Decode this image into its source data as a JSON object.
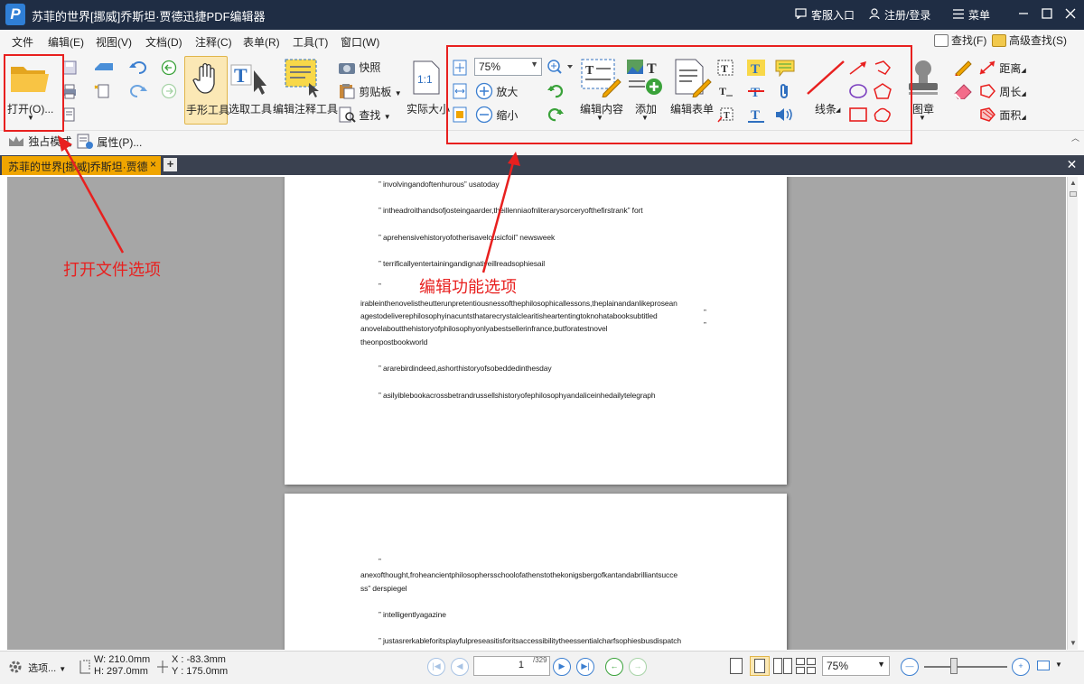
{
  "titlebar": {
    "title": "苏菲的世界[挪威]乔斯坦·贾德迅捷PDF编辑器",
    "service": "客服入口",
    "login": "注册/登录",
    "menu": "菜单"
  },
  "menubar": {
    "items": [
      "文件",
      "编辑(E)",
      "视图(V)",
      "文档(D)",
      "注释(C)",
      "表单(R)",
      "工具(T)",
      "窗口(W)"
    ],
    "find": "查找(F)",
    "advanced_find": "高级查找(S)"
  },
  "ribbon": {
    "open": "打开(O)...",
    "hand_tool": "手形工具",
    "select_tool": "选取工具",
    "edit_annotation_tool": "编辑注释工具",
    "snapshot": "快照",
    "clipboard": "剪贴板",
    "find": "查找",
    "actual_size": "实际大小",
    "zoom_value": "75%",
    "zoom_in": "放大",
    "zoom_out": "缩小",
    "edit_content": "编辑内容",
    "add": "添加",
    "edit_form": "编辑表单",
    "lines": "线条",
    "stamp": "图章",
    "distance": "距离",
    "perimeter": "周长",
    "area": "面积",
    "exclusive_mode": "独占模式",
    "properties": "属性(P)..."
  },
  "tab": {
    "label": "苏菲的世界[挪威]乔斯坦·贾德",
    "close": "×",
    "add": "+"
  },
  "page1": {
    "lines": [
      "” involvingandoftenhurous” usatoday",
      "” intheadroithandsofjosteingaarder,theillenniaofnliterarysorceryofthefirstrank” fort",
      "” aprehensivehistoryofotherisavelousicfoil” newsweek",
      "” terrificallyentertainingandignativeillreadsophiesail",
      "”",
      "irableinthenovelistheutterunpretentiousnessofthephilosophicallessons,theplainandanlikeprosean",
      "agestodeliverephilosophyinacuntsthatarecrystalclearitisheartentingtoknohatabooksubtitled",
      "anovelaboutthehistoryofphilosophyonlyabestsellerinfrance,butforatestnovel",
      "theonpostbookworld",
      "” ararebirdindeed,ashorthistoryofsobeddedinthesday",
      "” asilyiblebookacrossbetrandrussellshistoryofephilosophyandaliceinhedailytelegraph"
    ],
    "trailing_quote": "”"
  },
  "page2": {
    "lines": [
      "”",
      "anexofthought,froheancientphilosophersschoolofathenstothekonigsbergofkantandabrilliantsucce",
      "ss” derspiegel",
      "” intelligentlyagazine",
      "” justasrerkableforitsplayfulpreseasitisforitsaccessibilitytheessentialcharfsophiesbusdispatch"
    ]
  },
  "statusbar": {
    "options": "选项...",
    "width": "W: 210.0mm",
    "height": "H: 297.0mm",
    "x": "X : -83.3mm",
    "y": "Y : 175.0mm",
    "current_page": "1",
    "total_pages": "329",
    "zoom": "75%"
  },
  "annotations": {
    "open_label": "打开文件选项",
    "edit_label": "编辑功能选项",
    "color": "#e8201f"
  }
}
